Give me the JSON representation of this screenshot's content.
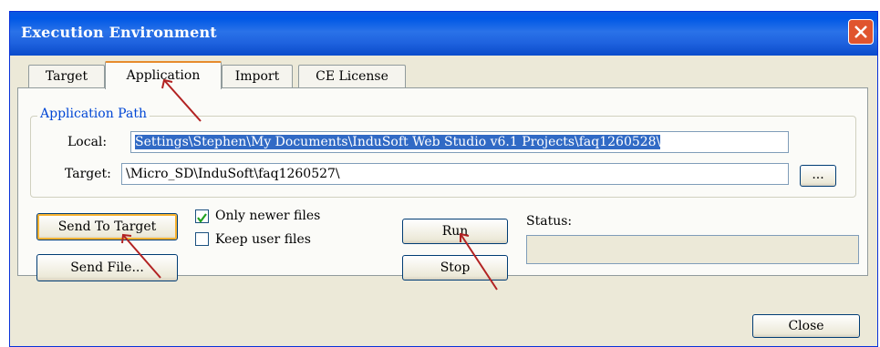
{
  "window": {
    "title": "Execution Environment",
    "close_icon": "close-x-icon"
  },
  "tabs": [
    {
      "label": "Target"
    },
    {
      "label": "Application"
    },
    {
      "label": "Import"
    },
    {
      "label": "CE License"
    }
  ],
  "application_path": {
    "group_label": "Application Path",
    "local_label": "Local:",
    "local_value": "Settings\\Stephen\\My Documents\\InduSoft Web Studio v6.1 Projects\\faq1260528\\",
    "target_label": "Target:",
    "target_value": "\\Micro_SD\\InduSoft\\faq1260527\\",
    "browse_label": "..."
  },
  "actions": {
    "send_to_target": "Send To Target",
    "send_file": "Send File...",
    "only_newer_files": "Only newer files",
    "only_newer_files_checked": true,
    "keep_user_files": "Keep user files",
    "keep_user_files_checked": false,
    "run": "Run",
    "stop": "Stop",
    "status_label": "Status:",
    "status_value": ""
  },
  "footer": {
    "close": "Close"
  },
  "annotation_color": "#b22222"
}
